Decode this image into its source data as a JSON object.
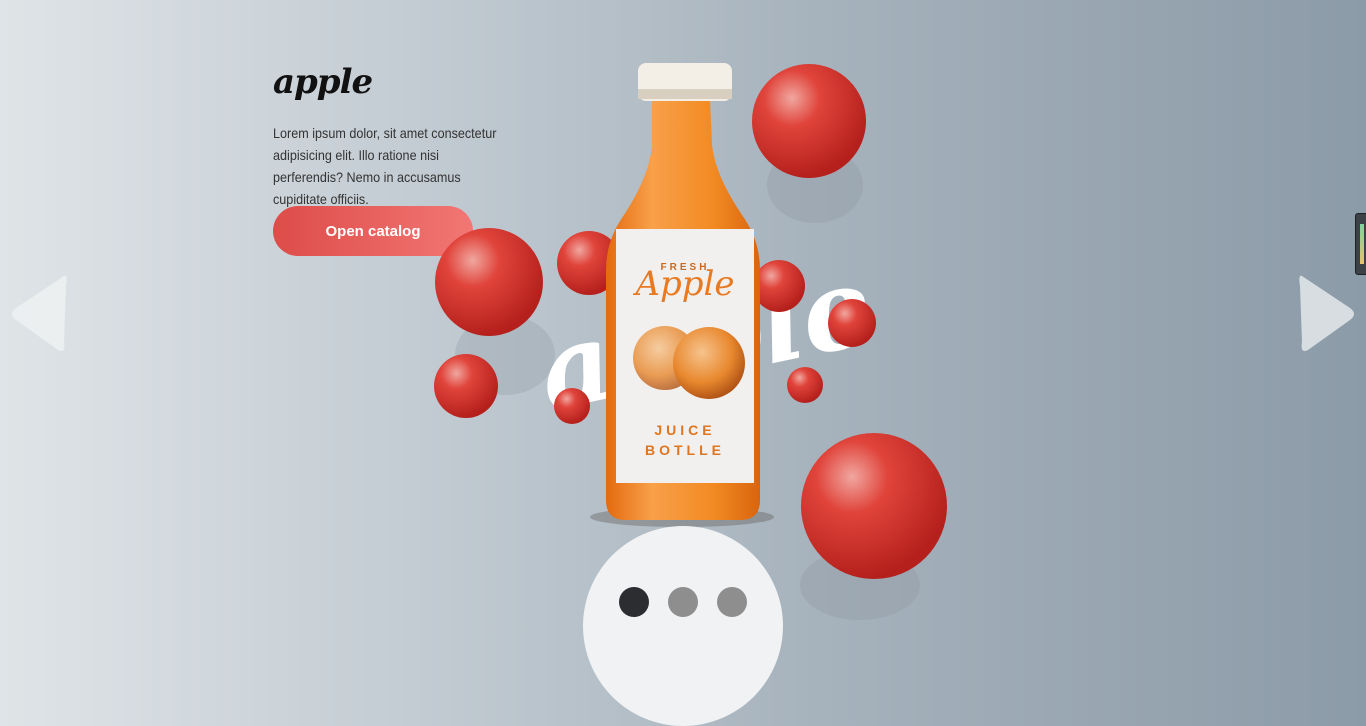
{
  "brand": {
    "logo_text": "apple"
  },
  "hero": {
    "description": "Lorem ipsum dolor, sit amet consectetur adipisicing elit. Illo ratione nisi perferendis? Nemo in accusamus cupiditate officiis.",
    "cta_label": "Open catalog",
    "big_word": "apple"
  },
  "product": {
    "label_top": "FRESH",
    "label_name": "Apple",
    "label_line1": "JUICE",
    "label_line2": "BOTLLE"
  },
  "slider": {
    "dots": [
      {
        "active": true,
        "color": "#2b2d30"
      },
      {
        "active": false,
        "color": "#8e8e8e"
      },
      {
        "active": false,
        "color": "#8e8e8e"
      }
    ]
  },
  "colors": {
    "accent": "#e4504d",
    "accent_light": "#f27774",
    "bottle": "#f2821c",
    "apple": "#d7302b"
  },
  "icons": {
    "prev": "triangle-left-icon",
    "next": "triangle-right-icon"
  }
}
